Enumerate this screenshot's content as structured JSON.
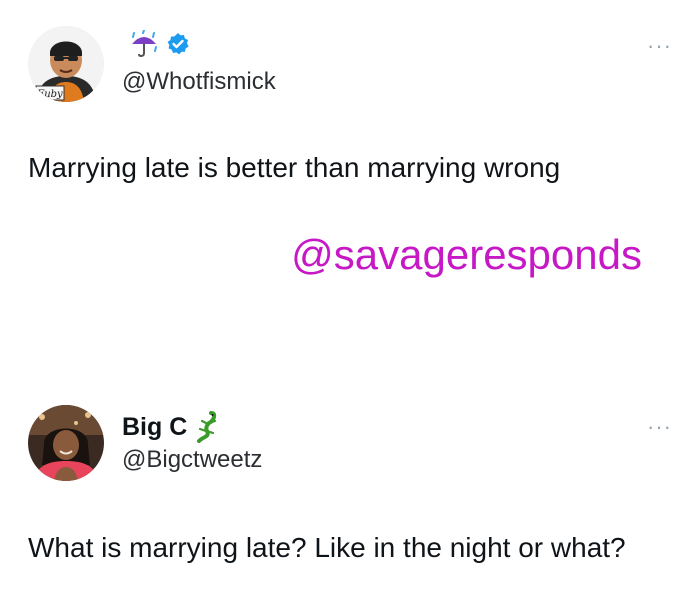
{
  "tweets": [
    {
      "display_name": "",
      "name_icons": [
        "umbrella-with-rain-icon",
        "verified-badge-icon"
      ],
      "handle": "@Whotfismick",
      "more_icon": "ellipsis-icon",
      "more_label": "···",
      "text": "Marrying late is better than marrying wrong",
      "avatar_caption": "Fuby"
    },
    {
      "display_name": "Big C",
      "name_icons": [
        "lizard-icon"
      ],
      "handle": "@Bigctweetz",
      "more_icon": "ellipsis-icon",
      "more_label": "···",
      "text": "What is marrying late? Like in the night or what?"
    }
  ],
  "watermark": "@savageresponds",
  "colors": {
    "watermark": "#c718c6",
    "verified": "#1d9bf0",
    "umbrella": "#7b3fc4",
    "lizard": "#3a9a2a"
  }
}
